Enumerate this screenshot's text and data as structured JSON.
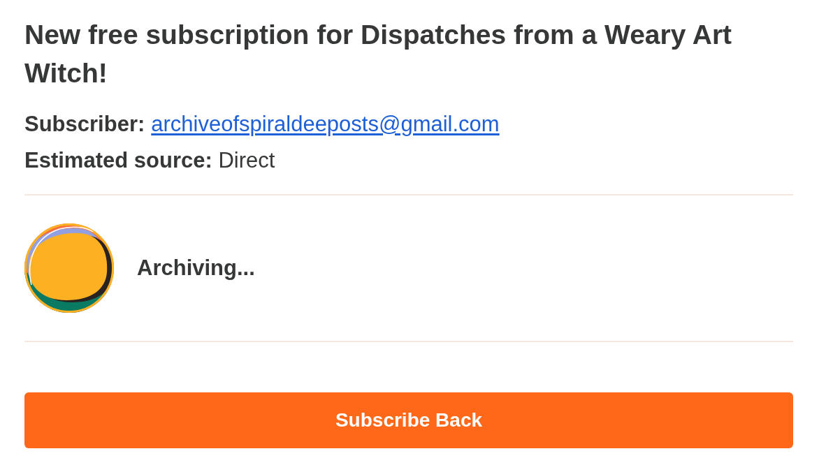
{
  "title": "New free subscription for Dispatches from a Weary Art Witch!",
  "subscriber": {
    "label": "Subscriber:",
    "email": "archiveofspiraldeeposts@gmail.com"
  },
  "source": "**Estimated source:** Direct",
  "publication": {
    "name": "Archiving..."
  },
  "button": {
    "label": "Subscribe Back"
  }
}
